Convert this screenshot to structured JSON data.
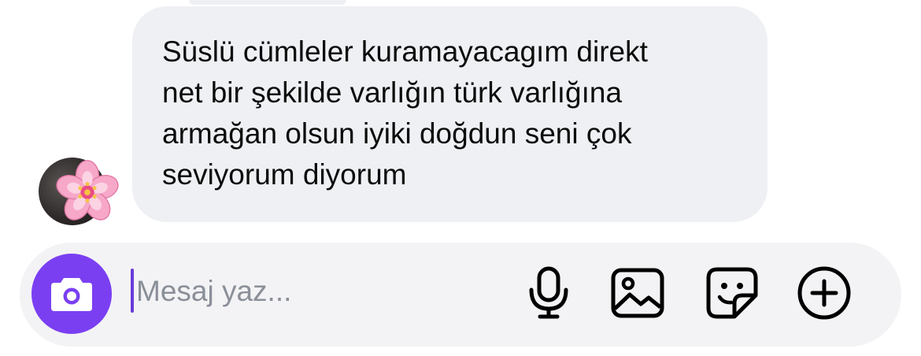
{
  "message": {
    "text": "Süslü cümleler kuramayacagım direkt\nnet bir şekilde varlığın türk varlığına\narmağan olsun iyiki doğdun seni çok\nseviyorum diyorum",
    "avatar_icon": "cherry-blossom"
  },
  "composer": {
    "placeholder": "Mesaj yaz...",
    "camera_icon": "camera-icon",
    "mic_icon": "microphone-icon",
    "gallery_icon": "image-icon",
    "sticker_icon": "sticker-icon",
    "plus_icon": "plus-circle-icon",
    "accent_color": "#7b3ff2"
  }
}
